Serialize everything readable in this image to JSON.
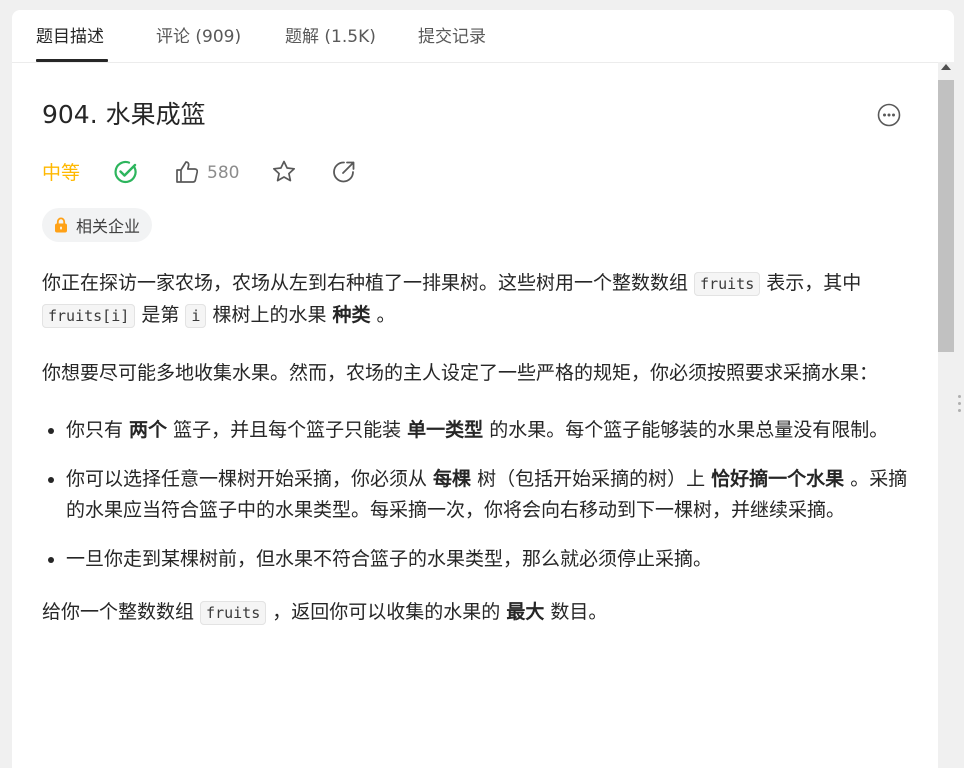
{
  "tabs": [
    {
      "label": "题目描述",
      "active": true
    },
    {
      "label": "评论 (909)",
      "active": false
    },
    {
      "label": "题解 (1.5K)",
      "active": false
    },
    {
      "label": "提交记录",
      "active": false
    }
  ],
  "problem": {
    "title": "904. 水果成篮",
    "difficulty": "中等",
    "likes": "580",
    "tag_label": "相关企业"
  },
  "description": {
    "p1": {
      "t1": "你正在探访一家农场，农场从左到右种植了一排果树。这些树用一个整数数组 ",
      "c1": "fruits",
      "t2": " 表示，其中 ",
      "c2": "fruits[i]",
      "t3": " 是第 ",
      "c3": "i",
      "t4": " 棵树上的水果 ",
      "b1": "种类",
      "t5": " 。"
    },
    "p2": "你想要尽可能多地收集水果。然而，农场的主人设定了一些严格的规矩，你必须按照要求采摘水果：",
    "rules": {
      "r1": {
        "t1": "你只有 ",
        "b1": "两个",
        "t2": " 篮子，并且每个篮子只能装 ",
        "b2": "单一类型",
        "t3": " 的水果。每个篮子能够装的水果总量没有限制。"
      },
      "r2": {
        "t1": "你可以选择任意一棵树开始采摘，你必须从 ",
        "b1": "每棵",
        "t2": " 树（包括开始采摘的树）上 ",
        "b2": "恰好摘一个水果",
        "t3": " 。采摘的水果应当符合篮子中的水果类型。每采摘一次，你将会向右移动到下一棵树，并继续采摘。"
      },
      "r3": {
        "t1": "一旦你走到某棵树前，但水果不符合篮子的水果类型，那么就必须停止采摘。"
      }
    },
    "p3": {
      "t1": "给你一个整数数组 ",
      "c1": "fruits",
      "t2": " ，返回你可以收集的水果的 ",
      "b1": "最大",
      "t3": " 数目。"
    }
  },
  "colors": {
    "difficulty": "#ffb800",
    "solved_check": "#2db55d",
    "lock": "#ffa116"
  },
  "icons": [
    "more-icon",
    "solved-check-icon",
    "thumbs-up-icon",
    "star-icon",
    "share-icon",
    "lock-icon"
  ]
}
